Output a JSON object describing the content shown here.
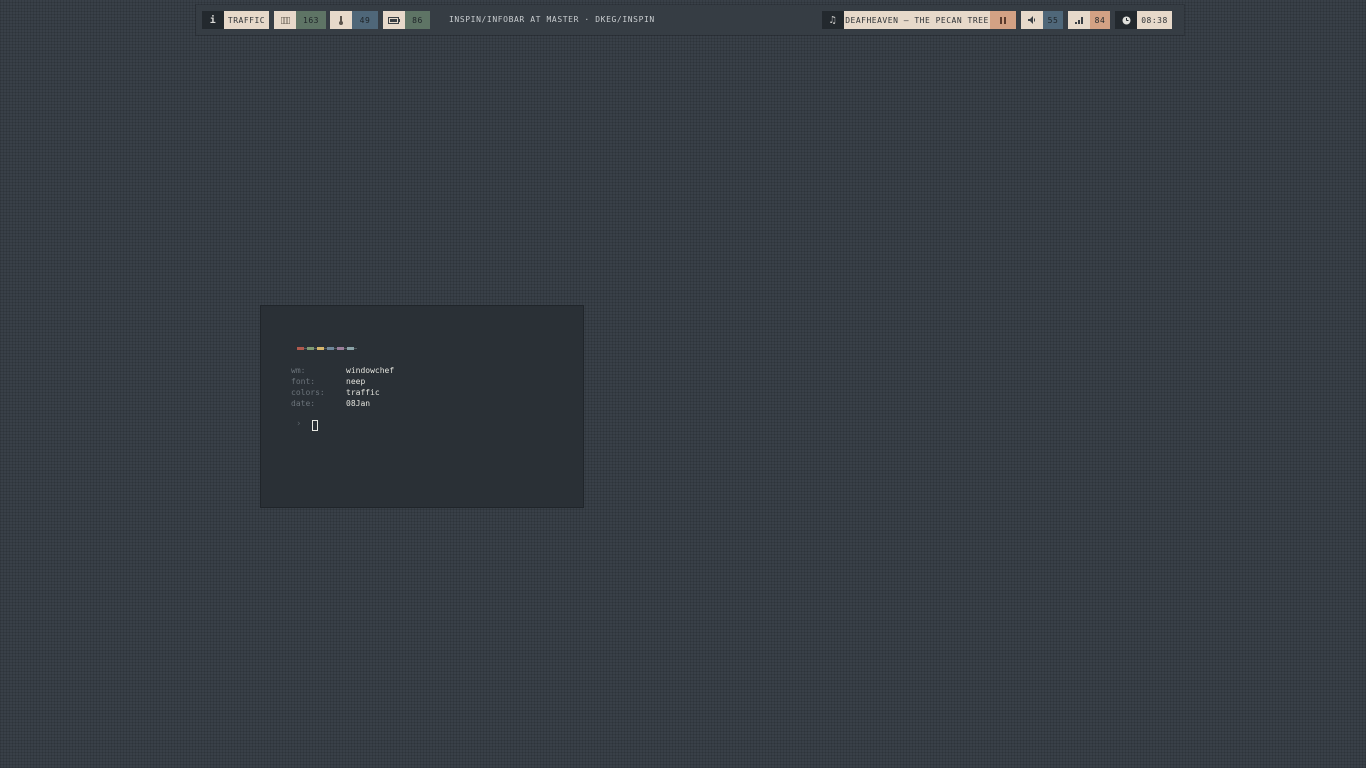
{
  "bar": {
    "left": {
      "info_icon": "i",
      "workspace": "TRAFFIC",
      "memory_icon": "memory-icon",
      "memory_value": "163",
      "temp_icon": "thermometer-icon",
      "temp_value": "49",
      "battery_icon": "battery-icon",
      "battery_value": "86"
    },
    "title": "INSPIN/INFOBAR AT MASTER · DKEG/INSPIN",
    "right": {
      "music_icon": "♫",
      "song": "DEAFHEAVEN – THE PECAN TREE",
      "pause_icon": "pause-icon",
      "volume_icon": "volume-icon",
      "volume_value": "55",
      "wifi_icon": "signal-icon",
      "wifi_value": "84",
      "clock_icon": "clock-icon",
      "time": "08:38"
    }
  },
  "terminal": {
    "colors": [
      "#b05a4e",
      "#7f9a73",
      "#d6b56c",
      "#6f879a",
      "#9a7e9a",
      "#8aa3a8"
    ],
    "info": [
      {
        "key": "wm:",
        "value": "windowchef"
      },
      {
        "key": "font:",
        "value": "neep"
      },
      {
        "key": "colors:",
        "value": "traffic"
      },
      {
        "key": "date:",
        "value": "08Jan"
      }
    ],
    "prompt": "›"
  }
}
